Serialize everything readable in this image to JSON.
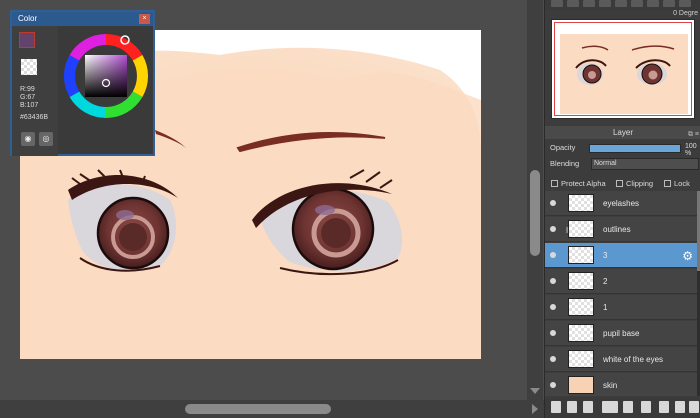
{
  "color_panel": {
    "title": "Color",
    "close": "×",
    "rgb": [
      "R:99",
      "G:67",
      "B:107"
    ],
    "hex": "#63436B",
    "main_color": "#63436B"
  },
  "navigator": {
    "degree": "0 Degre"
  },
  "layer_panel": {
    "title": "Layer",
    "opacity_label": "Opacity",
    "opacity_value": "100",
    "opacity_display": "100 %",
    "blending_label": "Blending",
    "blending_value": "Normal",
    "protect_alpha": "Protect Alpha",
    "clipping": "Clipping",
    "lock": "Lock",
    "selected_color": "#5a98cf",
    "layers": [
      {
        "name": "eyelashes",
        "selected": false
      },
      {
        "name": "outlines",
        "selected": false
      },
      {
        "name": "3",
        "selected": true
      },
      {
        "name": "2",
        "selected": false
      },
      {
        "name": "1",
        "selected": false
      },
      {
        "name": "pupil base",
        "selected": false
      },
      {
        "name": "white of the eyes",
        "selected": false
      },
      {
        "name": "skin",
        "selected": false
      }
    ]
  }
}
